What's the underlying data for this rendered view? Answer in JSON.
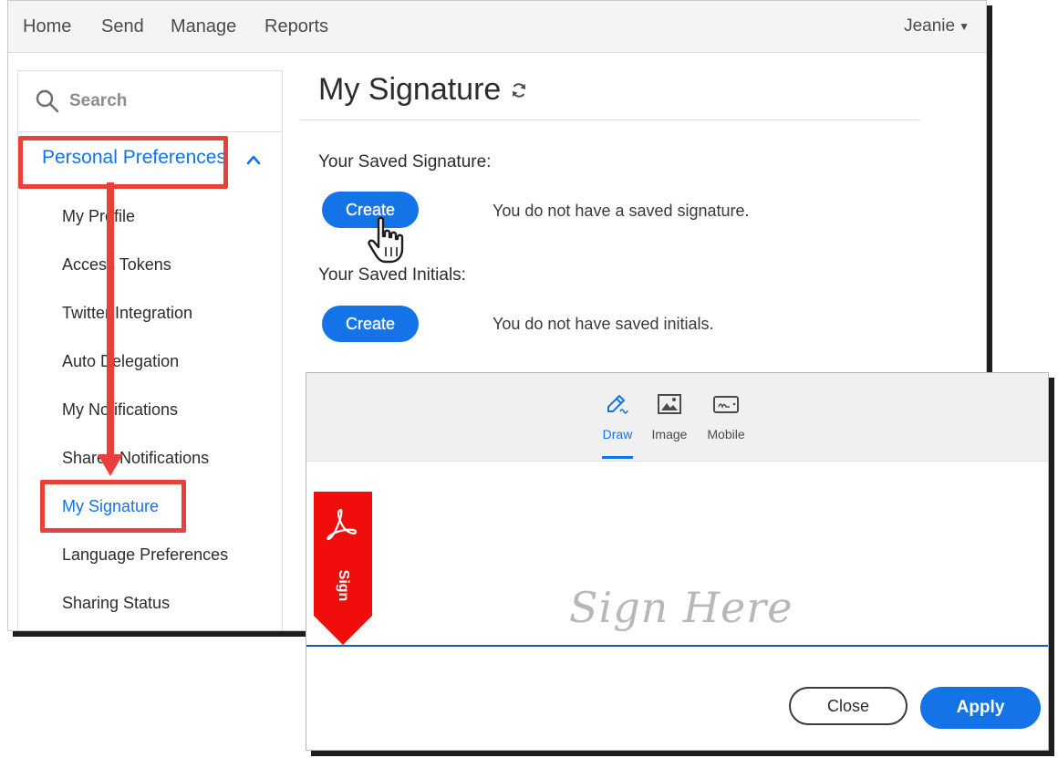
{
  "top_nav": {
    "items": [
      {
        "label": "Home"
      },
      {
        "label": "Send"
      },
      {
        "label": "Manage"
      },
      {
        "label": "Reports"
      }
    ],
    "user_name": "Jeanie"
  },
  "sidebar": {
    "search_placeholder": "Search",
    "section_title": "Personal Preferences",
    "items": [
      {
        "label": "My Profile"
      },
      {
        "label": "Access Tokens"
      },
      {
        "label": "Twitter Integration"
      },
      {
        "label": "Auto Delegation"
      },
      {
        "label": "My Notifications"
      },
      {
        "label": "Shared Notifications"
      },
      {
        "label": "My Signature",
        "active": true
      },
      {
        "label": "Language Preferences"
      },
      {
        "label": "Sharing Status"
      }
    ]
  },
  "main": {
    "title": "My Signature",
    "signature_label": "Your Saved Signature:",
    "signature_create": "Create",
    "signature_status": "You do not have a saved signature.",
    "initials_label": "Your Saved Initials:",
    "initials_create": "Create",
    "initials_status": "You do not have saved initials."
  },
  "dialog": {
    "tabs": [
      {
        "label": "Draw",
        "icon": "pen-icon",
        "active": true
      },
      {
        "label": "Image",
        "icon": "image-icon"
      },
      {
        "label": "Mobile",
        "icon": "mobile-icon"
      }
    ],
    "sign_flag_label": "Sign",
    "placeholder": "Sign Here",
    "close_label": "Close",
    "apply_label": "Apply"
  },
  "colors": {
    "accent": "#1473e6",
    "annotation": "#e8403a",
    "flag": "#f20d0d"
  }
}
